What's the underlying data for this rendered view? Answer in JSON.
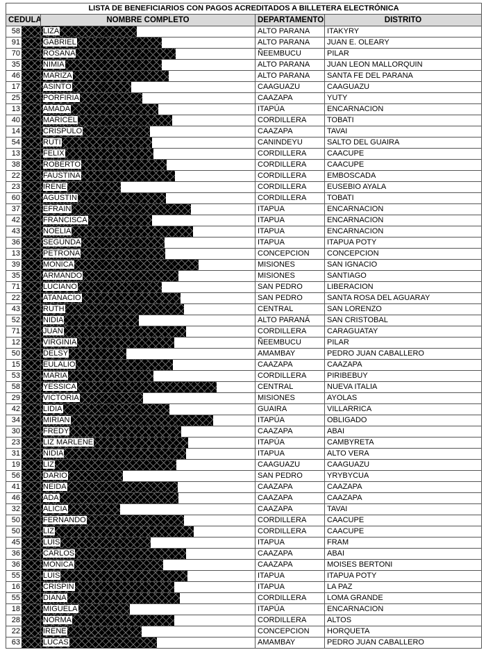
{
  "document": {
    "title": "LISTA DE BENEFICIARIOS CON PAGOS ACREDITADOS A BILLETERA ELECTRÓNICA",
    "columns": [
      "CEDULA",
      "NOMBRE COMPLETO",
      "DEPARTAMENTO",
      "DISTRITO"
    ],
    "redaction_color": "#000000",
    "header_background": "#d9d9d9",
    "rows": [
      {
        "cedula": "58",
        "nombre": "LIZA",
        "departamento": "ALTO PARANA",
        "distrito": "ITAKYRY"
      },
      {
        "cedula": "91",
        "nombre": "GABRIEL",
        "departamento": "ALTO PARANA",
        "distrito": "JUAN E. OLEARY"
      },
      {
        "cedula": "70",
        "nombre": "ROSANA",
        "departamento": "ÑEEMBUCU",
        "distrito": "PILAR"
      },
      {
        "cedula": "35",
        "nombre": "NIMIA",
        "departamento": "ALTO PARANA",
        "distrito": "JUAN LEON MALLORQUIN"
      },
      {
        "cedula": "46",
        "nombre": "MARIZA",
        "departamento": "ALTO PARANA",
        "distrito": "SANTA FE DEL PARANA"
      },
      {
        "cedula": "17",
        "nombre": "ASINTO",
        "departamento": "CAAGUAZU",
        "distrito": "CAAGUAZU"
      },
      {
        "cedula": "25",
        "nombre": "PORFIRIA",
        "departamento": "CAAZAPA",
        "distrito": "YUTY"
      },
      {
        "cedula": "13",
        "nombre": "AMADA",
        "departamento": "ITAPÚA",
        "distrito": "ENCARNACION"
      },
      {
        "cedula": "40",
        "nombre": "MARICEL",
        "departamento": "CORDILLERA",
        "distrito": "TOBATI"
      },
      {
        "cedula": "14",
        "nombre": "CRISPULO",
        "departamento": "CAAZAPA",
        "distrito": "TAVAI"
      },
      {
        "cedula": "54",
        "nombre": "RUTI",
        "departamento": "CANINDEYU",
        "distrito": "SALTO DEL GUAIRA"
      },
      {
        "cedula": "13",
        "nombre": "FELIX",
        "departamento": "CORDILLERA",
        "distrito": "CAACUPE"
      },
      {
        "cedula": "38",
        "nombre": "ROBERTO",
        "departamento": "CORDILLERA",
        "distrito": "CAACUPE"
      },
      {
        "cedula": "22",
        "nombre": "FAUSTINA",
        "departamento": "CORDILLERA",
        "distrito": "EMBOSCADA"
      },
      {
        "cedula": "23",
        "nombre": "IRENE",
        "departamento": "CORDILLERA",
        "distrito": "EUSEBIO AYALA"
      },
      {
        "cedula": "60",
        "nombre": "AGUSTIN",
        "departamento": "CORDILLERA",
        "distrito": "TOBATI"
      },
      {
        "cedula": "37",
        "nombre": "EFRAIN",
        "departamento": "ITAPUA",
        "distrito": "ENCARNACION"
      },
      {
        "cedula": "42",
        "nombre": "FRANCISCA",
        "departamento": "ITAPUA",
        "distrito": "ENCARNACION"
      },
      {
        "cedula": "43",
        "nombre": "NOELIA",
        "departamento": "ITAPUA",
        "distrito": "ENCARNACION"
      },
      {
        "cedula": "36",
        "nombre": "SEGUNDA",
        "departamento": "ITAPUA",
        "distrito": "ITAPUA POTY"
      },
      {
        "cedula": "13",
        "nombre": "PETRONA",
        "departamento": "CONCEPCION",
        "distrito": "CONCEPCION"
      },
      {
        "cedula": "39",
        "nombre": "MONICA",
        "departamento": "MISIONES",
        "distrito": "SAN IGNACIO"
      },
      {
        "cedula": "35",
        "nombre": "ARMANDO",
        "departamento": "MISIONES",
        "distrito": "SANTIAGO"
      },
      {
        "cedula": "71",
        "nombre": "LUCIANO",
        "departamento": "SAN PEDRO",
        "distrito": "LIBERACION"
      },
      {
        "cedula": "22",
        "nombre": "ATANACIO",
        "departamento": "SAN PEDRO",
        "distrito": "SANTA ROSA DEL AGUARAY"
      },
      {
        "cedula": "43",
        "nombre": "RUTH",
        "departamento": "CENTRAL",
        "distrito": "SAN LORENZO"
      },
      {
        "cedula": "52",
        "nombre": "NIDIA",
        "departamento": "ALTO PARANÁ",
        "distrito": "SAN CRISTOBAL"
      },
      {
        "cedula": "71",
        "nombre": "JUAN",
        "departamento": "CORDILLERA",
        "distrito": "CARAGUATAY"
      },
      {
        "cedula": "12",
        "nombre": "VIRGINIA",
        "departamento": "ÑEEMBUCU",
        "distrito": "PILAR"
      },
      {
        "cedula": "50",
        "nombre": "DELSY",
        "departamento": "AMAMBAY",
        "distrito": "PEDRO JUAN CABALLERO"
      },
      {
        "cedula": "15",
        "nombre": "EULALIO",
        "departamento": "CAAZAPA",
        "distrito": "CAAZAPA"
      },
      {
        "cedula": "53",
        "nombre": "MARIA",
        "departamento": "CORDILLERA",
        "distrito": "PIRIBEBUY"
      },
      {
        "cedula": "58",
        "nombre": "YESSICA",
        "departamento": "CENTRAL",
        "distrito": "NUEVA ITALIA"
      },
      {
        "cedula": "29",
        "nombre": "VICTORIA",
        "departamento": "MISIONES",
        "distrito": "AYOLAS"
      },
      {
        "cedula": "42",
        "nombre": "LIDIA",
        "departamento": "GUAIRA",
        "distrito": "VILLARRICA"
      },
      {
        "cedula": "34",
        "nombre": "MIRIAN",
        "departamento": "ITAPÚA",
        "distrito": "OBLIGADO"
      },
      {
        "cedula": "30",
        "nombre": "FREDY",
        "departamento": "CAAZAPA",
        "distrito": "ABAI"
      },
      {
        "cedula": "23",
        "nombre": "LIZ MARLENE",
        "departamento": "ITAPÚA",
        "distrito": "CAMBYRETA"
      },
      {
        "cedula": "31",
        "nombre": "NIDIA",
        "departamento": "ITAPUA",
        "distrito": "ALTO VERA"
      },
      {
        "cedula": "19",
        "nombre": "LIZ",
        "departamento": "CAAGUAZU",
        "distrito": "CAAGUAZU"
      },
      {
        "cedula": "56",
        "nombre": "DARIO",
        "departamento": "SAN PEDRO",
        "distrito": "YRYBYCUA"
      },
      {
        "cedula": "41",
        "nombre": "NEIDA",
        "departamento": "CAAZAPA",
        "distrito": "CAAZAPA"
      },
      {
        "cedula": "46",
        "nombre": "ADA",
        "departamento": "CAAZAPA",
        "distrito": "CAAZAPA"
      },
      {
        "cedula": "32",
        "nombre": "ALICIA",
        "departamento": "CAAZAPA",
        "distrito": "TAVAI"
      },
      {
        "cedula": "50",
        "nombre": "FERNANDO",
        "departamento": "CORDILLERA",
        "distrito": "CAACUPE"
      },
      {
        "cedula": "50",
        "nombre": "LIZ",
        "departamento": "CORDILLERA",
        "distrito": "CAACUPE"
      },
      {
        "cedula": "45",
        "nombre": "LUIS",
        "departamento": "ITAPUA",
        "distrito": "FRAM"
      },
      {
        "cedula": "36",
        "nombre": "CARLOS",
        "departamento": "CAAZAPA",
        "distrito": "ABAI"
      },
      {
        "cedula": "36",
        "nombre": "MONICA",
        "departamento": "CAAZAPA",
        "distrito": "MOISES BERTONI"
      },
      {
        "cedula": "55",
        "nombre": "LUIS",
        "departamento": "ITAPUA",
        "distrito": "ITAPUA POTY"
      },
      {
        "cedula": "16",
        "nombre": "CRISPIN",
        "departamento": "ITAPUA",
        "distrito": "LA PAZ"
      },
      {
        "cedula": "55",
        "nombre": "DIANA",
        "departamento": "CORDILLERA",
        "distrito": "LOMA GRANDE"
      },
      {
        "cedula": "18",
        "nombre": "MIGUELA",
        "departamento": "ITAPÚA",
        "distrito": "ENCARNACION"
      },
      {
        "cedula": "28",
        "nombre": "NORMA",
        "departamento": "CORDILLERA",
        "distrito": "ALTOS"
      },
      {
        "cedula": "22",
        "nombre": "IRENE",
        "departamento": "CONCEPCION",
        "distrito": "HORQUETA"
      },
      {
        "cedula": "63",
        "nombre": "LUCAS",
        "departamento": "AMAMBAY",
        "distrito": "PEDRO JUAN CABALLERO"
      }
    ]
  }
}
